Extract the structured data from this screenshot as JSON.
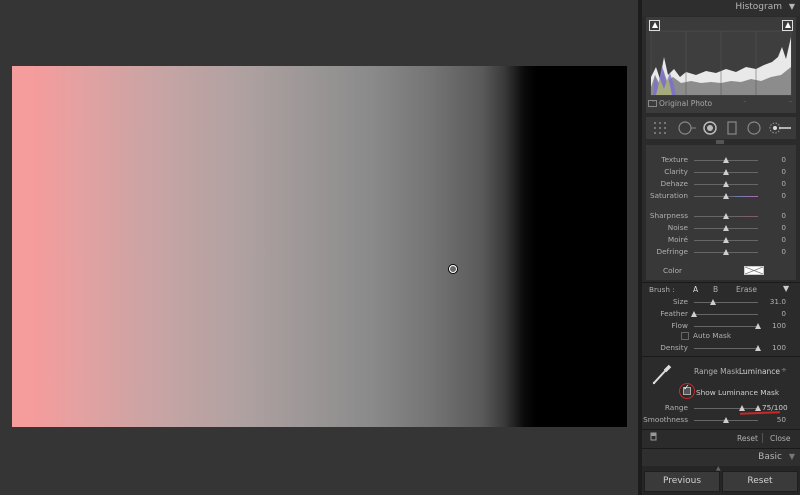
{
  "histogram": {
    "title": "Histogram",
    "original_photo": "Original Photo",
    "dashes": [
      "–",
      "–",
      "–",
      "–"
    ]
  },
  "adjustments": {
    "rows": [
      {
        "label": "Texture",
        "value": "0"
      },
      {
        "label": "Clarity",
        "value": "0"
      },
      {
        "label": "Dehaze",
        "value": "0"
      },
      {
        "label": "Saturation",
        "value": "0"
      },
      {
        "label": "Sharpness",
        "value": "0"
      },
      {
        "label": "Noise",
        "value": "0"
      },
      {
        "label": "Moiré",
        "value": "0"
      },
      {
        "label": "Defringe",
        "value": "0"
      }
    ],
    "color_label": "Color"
  },
  "brush": {
    "label": "Brush :",
    "tab_a": "A",
    "tab_b": "B",
    "tab_erase": "Erase",
    "size": {
      "label": "Size",
      "value": "31.0",
      "fraction": 0.31
    },
    "feather": {
      "label": "Feather",
      "value": "0",
      "fraction": 0.0
    },
    "flow": {
      "label": "Flow",
      "value": "100",
      "fraction": 1.0
    },
    "auto_mask": "Auto Mask",
    "density": {
      "label": "Density",
      "value": "100",
      "fraction": 1.0
    }
  },
  "range_mask": {
    "label": "Range Mask :",
    "value": "Luminance",
    "show_mask": "Show Luminance Mask",
    "show_mask_checked": true,
    "range": {
      "label": "Range",
      "value": "75/100",
      "low": 0.75,
      "high": 1.0
    },
    "smoothness": {
      "label": "Smoothness",
      "value": "50",
      "fraction": 0.5
    }
  },
  "footer": {
    "reset": "Reset",
    "close": "Close"
  },
  "basic": {
    "title": "Basic"
  },
  "buttons": {
    "previous": "Previous",
    "reset": "Reset"
  },
  "colors": {
    "accent_red": "#c8282a",
    "thumb": "#cfcfcf"
  }
}
